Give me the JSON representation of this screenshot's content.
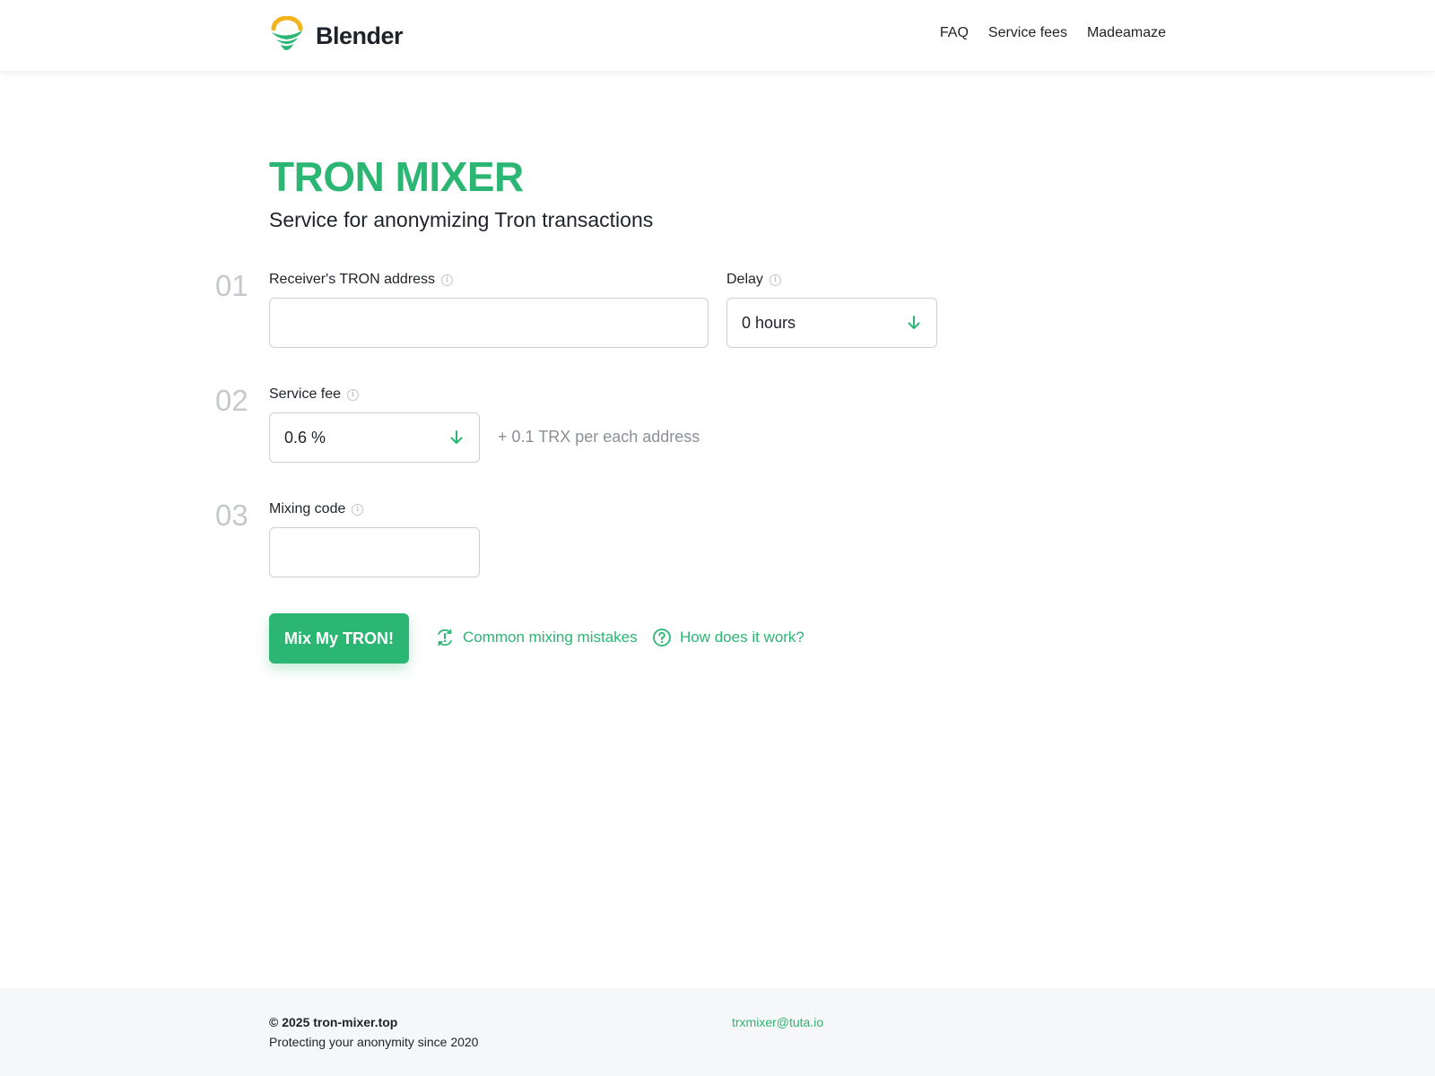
{
  "brand": {
    "name": "Blender",
    "accent": "#2bb673",
    "logo_icon": "tornado-logo-icon"
  },
  "nav": {
    "faq": "FAQ",
    "service_fees": "Service fees",
    "madeamaze": "Madeamaze"
  },
  "hero": {
    "title": "TRON MIXER",
    "subtitle": "Service for anonymizing Tron transactions"
  },
  "steps": {
    "s1": {
      "num": "01",
      "address_label": "Receiver's TRON address",
      "address_value": "",
      "delay_label": "Delay",
      "delay_value": "0 hours"
    },
    "s2": {
      "num": "02",
      "fee_label": "Service fee",
      "fee_value": "0.6 %",
      "fee_extra": "+ 0.1 TRX per each address"
    },
    "s3": {
      "num": "03",
      "code_label": "Mixing code",
      "code_value": ""
    }
  },
  "actions": {
    "mix_button": "Mix My TRON!",
    "mistakes_link": "Common mixing mistakes",
    "how_link": "How does it work?"
  },
  "footer": {
    "copyright": "© 2025 tron-mixer.top",
    "tagline": "Protecting your anonymity since 2020",
    "email": "trxmixer@tuta.io"
  }
}
